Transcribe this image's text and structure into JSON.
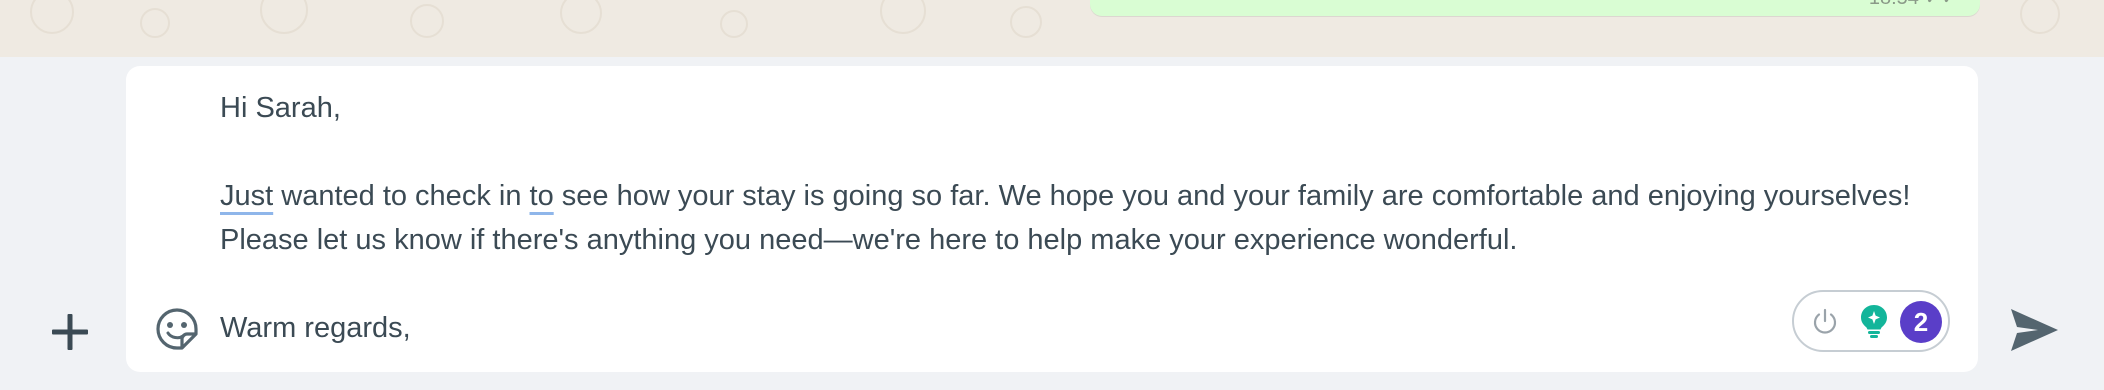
{
  "chat": {
    "last_message_time": "18:54",
    "bubble_color": "#d9fdd3",
    "wallpaper_color": "#efeae2"
  },
  "composer": {
    "greeting": "Hi Sarah,",
    "body_word_1": "Just",
    "body_part_2": " wanted to check in ",
    "body_word_3": "to",
    "body_part_4": " see how your stay is going so far. We hope you and your family are comfortable and enjoying yourselves! Please let us know if there's anything you need—we're here to help make your experience wonderful.",
    "closing": "Warm regards,",
    "text_color": "#3b4a54"
  },
  "toolbar": {
    "attach_icon": "plus-icon",
    "sticker_icon": "sticker-icon",
    "send_icon": "send-icon"
  },
  "assistant_pill": {
    "power_icon": "power-icon",
    "assistant_icon": "lightbulb-icon",
    "assistant_color": "#13b59a",
    "suggestion_count": "2",
    "badge_color": "#5a3ec8"
  }
}
